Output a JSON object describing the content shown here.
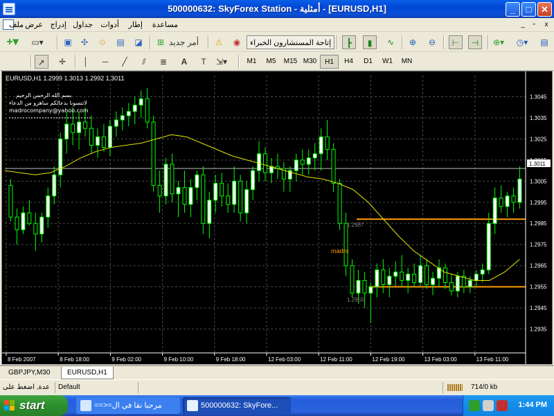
{
  "window": {
    "title": "500000632: SkyForex Station - أمثلية - [EURUSD,H1]",
    "min_label": "_",
    "max_label": "□",
    "close_label": "✕"
  },
  "menu": {
    "items": [
      "ملف",
      "عرض",
      "إدراج",
      "جداول",
      "أدوات",
      "إطار",
      "مساعدة"
    ],
    "mdi_min": "_",
    "mdi_restore": "▫",
    "mdi_close": "x"
  },
  "toolbar": {
    "new_order_label": "أمر جديد",
    "expert_advisors_label": "إتاحة المستشارون الخبراء"
  },
  "timeframes": {
    "items": [
      "M1",
      "M5",
      "M15",
      "M30",
      "H1",
      "H4",
      "D1",
      "W1",
      "MN"
    ],
    "active": "H1"
  },
  "chart": {
    "header": "EURUSD,H1  1.2999 1.3013 1.2992 1.3011",
    "annotation_lines": [
      "بسم الله الرحمن الرحيم",
      "لاتنسونا بدعائكم ساهرو من الدعاء",
      "madrocompany@yahoo.com"
    ],
    "current_price_label": "1.3011",
    "level_label_high": "1.2987",
    "level_label_low": "1.2955",
    "text_label": "madro",
    "colors": {
      "background": "#000000",
      "bull_candle": "#FFFFFF",
      "bear_candle": "#000000",
      "wick": "#00FF00",
      "grid": "#4A4A4A",
      "moving_average": "#E6E600",
      "level_line": "#FF9900",
      "price_line": "#C0C0C0",
      "label_text": "#FF9900"
    }
  },
  "chart_data": {
    "type": "candlestick",
    "title": "EURUSD,H1",
    "xlabel": "",
    "ylabel": "",
    "ylim": [
      1.2925,
      1.3055
    ],
    "y_ticks": [
      "1.3045",
      "1.3035",
      "1.3025",
      "1.3015",
      "1.3005",
      "1.2995",
      "1.2985",
      "1.2975",
      "1.2965",
      "1.2955",
      "1.2945",
      "1.2935"
    ],
    "x_ticks": [
      "8 Feb 2007",
      "8 Feb 18:00",
      "9 Feb 02:00",
      "9 Feb 10:00",
      "9 Feb 18:00",
      "12 Feb 03:00",
      "12 Feb 11:00",
      "12 Feb 19:00",
      "13 Feb 03:00",
      "13 Feb 11:00"
    ],
    "grid": true,
    "current_price": 1.3011,
    "horizontal_levels": [
      1.2987,
      1.2955
    ],
    "candles": [
      [
        1.3003,
        1.3006,
        1.2986,
        1.2988
      ],
      [
        1.2988,
        1.2992,
        1.2975,
        1.2982
      ],
      [
        1.2982,
        1.2993,
        1.298,
        1.299
      ],
      [
        1.299,
        1.2996,
        1.2984,
        1.2985
      ],
      [
        1.2985,
        1.299,
        1.2972,
        1.298
      ],
      [
        1.298,
        1.299,
        1.2976,
        1.2988
      ],
      [
        1.2988,
        1.3002,
        1.2983,
        1.2998
      ],
      [
        1.2998,
        1.3012,
        1.2994,
        1.3008
      ],
      [
        1.3008,
        1.3028,
        1.3002,
        1.3025
      ],
      [
        1.3025,
        1.3038,
        1.3018,
        1.3032
      ],
      [
        1.3032,
        1.304,
        1.3022,
        1.3028
      ],
      [
        1.3028,
        1.3038,
        1.302,
        1.3033
      ],
      [
        1.3033,
        1.304,
        1.3026,
        1.303
      ],
      [
        1.303,
        1.3036,
        1.3018,
        1.3022
      ],
      [
        1.3022,
        1.303,
        1.3016,
        1.3026
      ],
      [
        1.3026,
        1.3032,
        1.3019,
        1.3021
      ],
      [
        1.3021,
        1.3034,
        1.3017,
        1.3031
      ],
      [
        1.3031,
        1.3038,
        1.3026,
        1.3034
      ],
      [
        1.3034,
        1.304,
        1.3029,
        1.3036
      ],
      [
        1.3036,
        1.3042,
        1.3031,
        1.3038
      ],
      [
        1.3038,
        1.3045,
        1.3032,
        1.3041
      ],
      [
        1.3041,
        1.3048,
        1.3035,
        1.3044
      ],
      [
        1.3044,
        1.3049,
        1.303,
        1.3033
      ],
      [
        1.3033,
        1.3036,
        1.3,
        1.3003
      ],
      [
        1.3003,
        1.301,
        1.299,
        1.2998
      ],
      [
        1.2998,
        1.3016,
        1.2994,
        1.3013
      ],
      [
        1.3013,
        1.3018,
        1.2995,
        1.2999
      ],
      [
        1.2999,
        1.3005,
        1.2988,
        1.3002
      ],
      [
        1.3002,
        1.301,
        1.299,
        1.2994
      ],
      [
        1.2994,
        1.3006,
        1.2988,
        1.3002
      ],
      [
        1.3002,
        1.301,
        1.2996,
        1.3008
      ],
      [
        1.3008,
        1.3012,
        1.298,
        1.2985
      ],
      [
        1.2985,
        1.3,
        1.2978,
        1.2996
      ],
      [
        1.2996,
        1.3008,
        1.299,
        1.3004
      ],
      [
        1.3004,
        1.3009,
        1.2993,
        1.2998
      ],
      [
        1.2998,
        1.3004,
        1.299,
        1.2994
      ],
      [
        1.2994,
        1.3012,
        1.299,
        1.3005
      ],
      [
        1.3005,
        1.3008,
        1.2986,
        1.299
      ],
      [
        1.299,
        1.3005,
        1.2985,
        1.3001
      ],
      [
        1.3001,
        1.3012,
        1.2996,
        1.301
      ],
      [
        1.301,
        1.3024,
        1.3005,
        1.3018
      ],
      [
        1.3018,
        1.3021,
        1.3005,
        1.3009
      ],
      [
        1.3009,
        1.3016,
        1.3004,
        1.3012
      ],
      [
        1.3012,
        1.3018,
        1.3006,
        1.3011
      ],
      [
        1.3011,
        1.3014,
        1.3,
        1.3006
      ],
      [
        1.3006,
        1.3012,
        1.3,
        1.301
      ],
      [
        1.301,
        1.3018,
        1.3005,
        1.3015
      ],
      [
        1.3015,
        1.302,
        1.3008,
        1.3013
      ],
      [
        1.3013,
        1.302,
        1.3008,
        1.3016
      ],
      [
        1.3016,
        1.3023,
        1.301,
        1.3018
      ],
      [
        1.3018,
        1.303,
        1.301,
        1.3026
      ],
      [
        1.3026,
        1.3034,
        1.3015,
        1.302
      ],
      [
        1.302,
        1.3023,
        1.3,
        1.3004
      ],
      [
        1.3004,
        1.3006,
        1.2982,
        1.2985
      ],
      [
        1.2985,
        1.299,
        1.296,
        1.2965
      ],
      [
        1.2965,
        1.2968,
        1.295,
        1.2952
      ],
      [
        1.2952,
        1.2963,
        1.2947,
        1.2958
      ],
      [
        1.2958,
        1.2962,
        1.2945,
        1.2952
      ],
      [
        1.2952,
        1.2957,
        1.2938,
        1.2955
      ],
      [
        1.2955,
        1.2966,
        1.295,
        1.2963
      ],
      [
        1.2963,
        1.2968,
        1.2952,
        1.2956
      ],
      [
        1.2956,
        1.2964,
        1.295,
        1.296
      ],
      [
        1.296,
        1.2967,
        1.2955,
        1.2962
      ],
      [
        1.2962,
        1.297,
        1.2955,
        1.2958
      ],
      [
        1.2958,
        1.2964,
        1.2952,
        1.2961
      ],
      [
        1.2961,
        1.2966,
        1.2955,
        1.2957
      ],
      [
        1.2957,
        1.297,
        1.2955,
        1.2965
      ],
      [
        1.2965,
        1.2968,
        1.2954,
        1.2956
      ],
      [
        1.2956,
        1.2962,
        1.2951,
        1.2959
      ],
      [
        1.2959,
        1.2968,
        1.2955,
        1.2964
      ],
      [
        1.2964,
        1.2966,
        1.2954,
        1.2957
      ],
      [
        1.2957,
        1.2961,
        1.2951,
        1.2953
      ],
      [
        1.2953,
        1.2962,
        1.295,
        1.296
      ],
      [
        1.296,
        1.2963,
        1.2952,
        1.2955
      ],
      [
        1.2955,
        1.296,
        1.2952,
        1.2958
      ],
      [
        1.2958,
        1.2963,
        1.2955,
        1.2961
      ],
      [
        1.2961,
        1.2966,
        1.2957,
        1.2963
      ],
      [
        1.2963,
        1.299,
        1.2961,
        1.2985
      ],
      [
        1.2985,
        1.3002,
        1.298,
        1.2997
      ],
      [
        1.2997,
        1.3003,
        1.299,
        1.2993
      ],
      [
        1.2993,
        1.3,
        1.2988,
        1.2998
      ],
      [
        1.2998,
        1.3002,
        1.299,
        1.2995
      ],
      [
        1.2995,
        1.3012,
        1.2992,
        1.3006
      ]
    ],
    "moving_average": [
      1.301,
      1.3009,
      1.3008,
      1.3009,
      1.3012,
      1.3016,
      1.3019,
      1.3021,
      1.3022,
      1.3023,
      1.3025,
      1.3027,
      1.3026,
      1.3023,
      1.302,
      1.3017,
      1.3015,
      1.3013,
      1.3011,
      1.3009,
      1.3007,
      1.3006,
      1.3004,
      1.3001,
      1.2995,
      1.2987,
      1.2979,
      1.2972,
      1.2967,
      1.2962,
      1.296,
      1.2958,
      1.2958,
      1.2962,
      1.2968
    ]
  },
  "tabs": {
    "items": [
      "GBPJPY,M30",
      "EURUSD,H1"
    ],
    "active": "EURUSD,H1"
  },
  "status": {
    "help_text": "عدة, اضغط على",
    "profile": "Default",
    "traffic": "714/0 kb"
  },
  "taskbar": {
    "start_label": "start",
    "tasks": [
      "==>=مرحبا نقا في ال",
      "500000632: SkyFore..."
    ],
    "clock": "1:44 PM"
  }
}
